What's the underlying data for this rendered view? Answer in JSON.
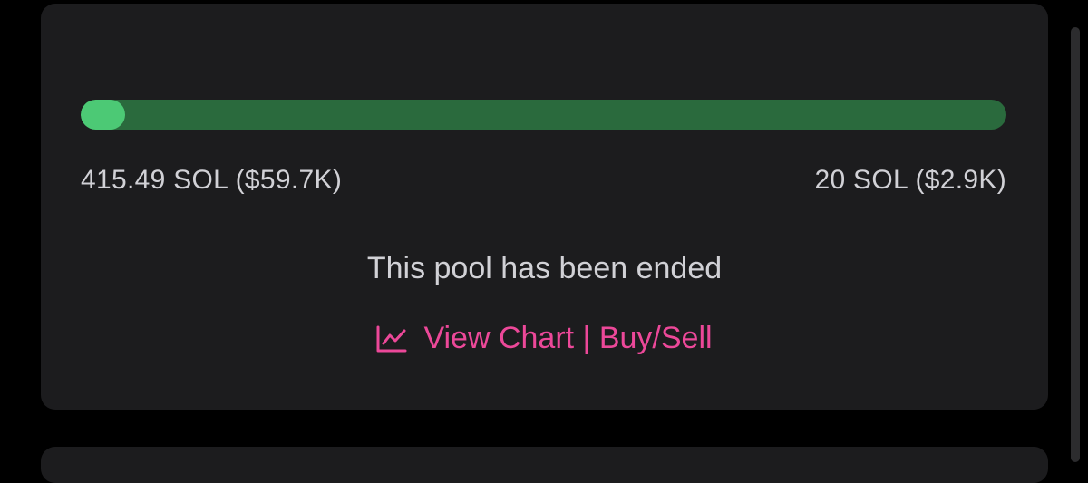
{
  "pool": {
    "progress_fraction": 0.035,
    "raised_amount": "415.49 SOL ($59.7K)",
    "target_amount": "20 SOL ($2.9K)",
    "status_text": "This pool has been ended",
    "link_icon": "line-chart-icon",
    "link_label": "View Chart | Buy/Sell"
  },
  "colors": {
    "card_background": "#1c1c1e",
    "progress_track": "#2a6a3d",
    "progress_fill": "#4cc975",
    "text": "#d1d1d6",
    "link": "#ec4899"
  }
}
